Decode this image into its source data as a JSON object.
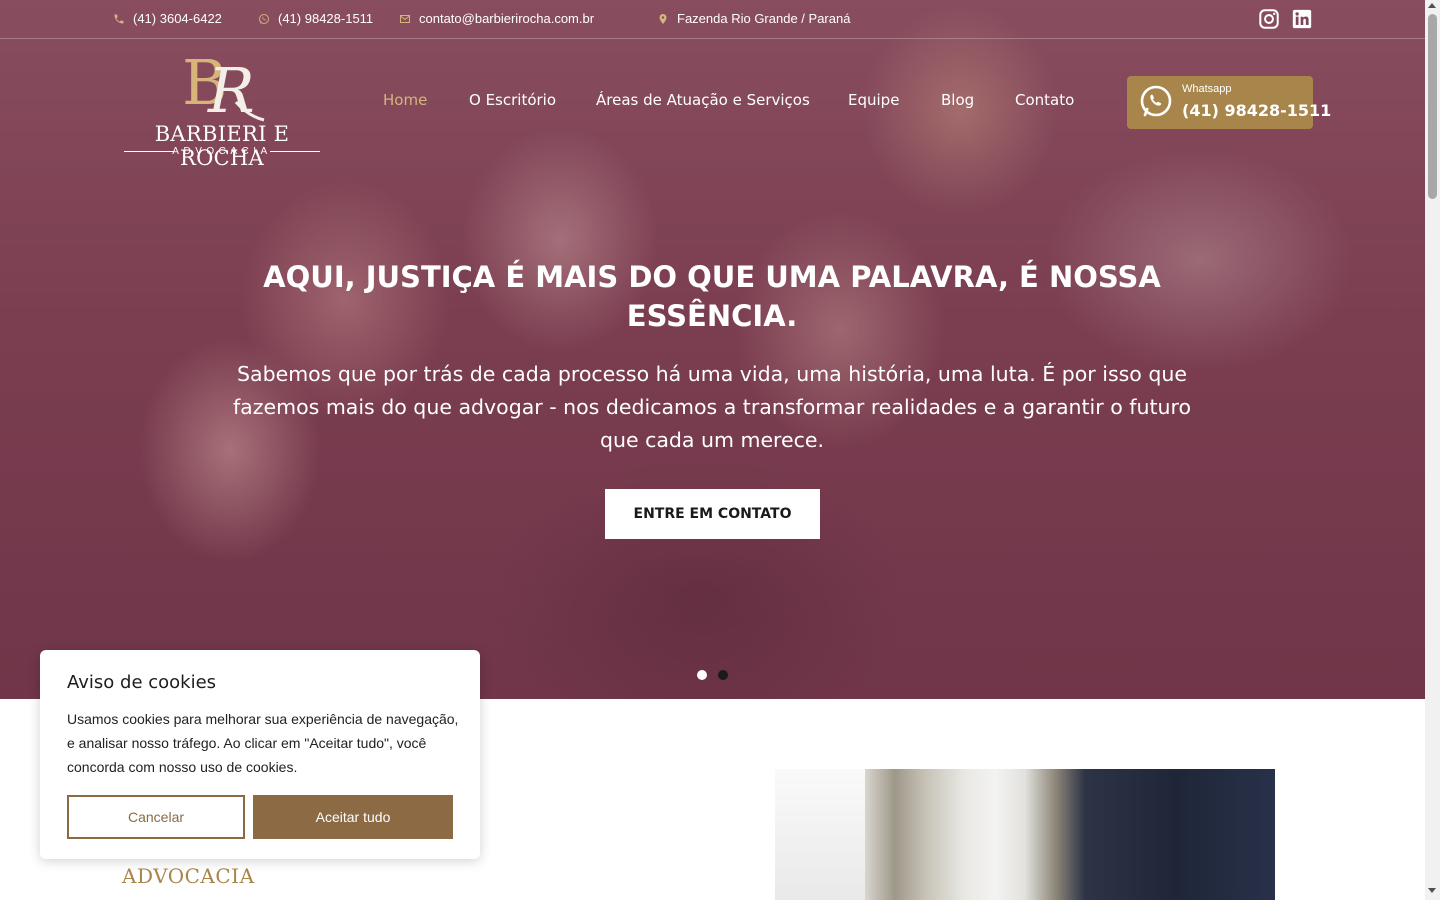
{
  "topbar": {
    "phone": "(41) 3604-6422",
    "whatsapp": "(41) 98428-1511",
    "email": "contato@barbierirocha.com.br",
    "location": "Fazenda Rio Grande / Paraná",
    "icons": [
      "phone-icon",
      "whatsapp-icon",
      "email-icon",
      "map-pin-icon",
      "instagram-icon",
      "linkedin-icon"
    ]
  },
  "logo": {
    "monogram": "BR",
    "brand": "BARBIERI E ROCHA",
    "sub": "ADVOCACIA"
  },
  "nav": {
    "items": [
      "Home",
      "O Escritório",
      "Áreas de Atuação e Serviços",
      "Equipe",
      "Blog",
      "Contato"
    ],
    "active": "Home"
  },
  "whatsapp_button": {
    "label": "Whatsapp",
    "number": "(41) 98428-1511"
  },
  "hero": {
    "title": "AQUI, JUSTIÇA É MAIS DO QUE UMA PALAVRA, É NOSSA ESSÊNCIA.",
    "text": "Sabemos que por trás de cada processo há uma vida, uma história, uma luta. É por isso que fazemos mais do que advogar - nos dedicamos a transformar realidades e a garantir o futuro que cada um merece.",
    "cta": "ENTRE EM CONTATO",
    "slides": 2,
    "active_slide": 1
  },
  "section": {
    "heading_fragment": "ADVOCACIA"
  },
  "cookie": {
    "title": "Aviso de cookies",
    "text": "Usamos cookies para melhorar sua experiência de navegação, e analisar nosso tráfego. Ao clicar em \"Aceitar tudo\", você concorda com nosso uso de cookies.",
    "cancel": "Cancelar",
    "accept": "Aceitar tudo"
  },
  "colors": {
    "gold": "#a8864b",
    "gold_light": "#d7b47a",
    "cookie_brown": "#8b6a44",
    "hero_tint": "#7d4657"
  }
}
